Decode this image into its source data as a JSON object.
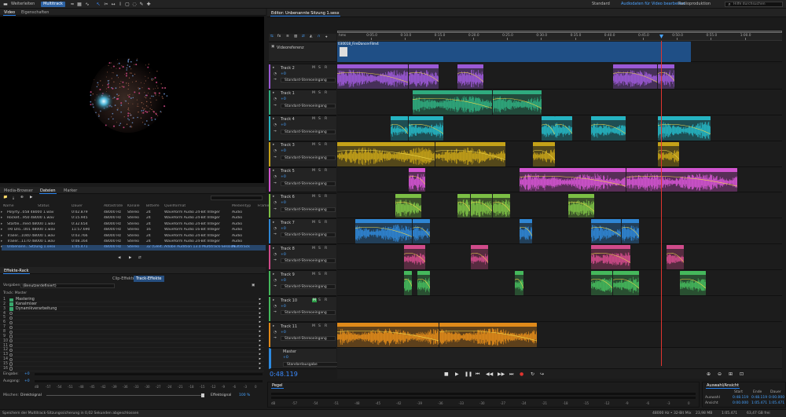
{
  "workspaces": [
    "Weiterleiten",
    "Multitrack"
  ],
  "top_right": {
    "items": [
      "Standard",
      "Audiodaten für Video bearbeiten",
      "Radioproduktion"
    ],
    "search_placeholder": "Hilfe durchsuchen"
  },
  "video_panel": {
    "tabs": [
      "Video",
      "Eigenschaften"
    ]
  },
  "media_panel": {
    "tabs": [
      "Media-Browser",
      "Dateien",
      "Marker"
    ],
    "columns": [
      "Name",
      "Status",
      "Dauer",
      "Abtastrate",
      "Kanäle",
      "Bittiefe",
      "Quellformat",
      "Medientyp",
      "Frame"
    ],
    "rows": [
      [
        "Polyrty...058 48000 1.wav",
        "",
        "0:02.879",
        "48000 Hz",
        "Stereo",
        "24",
        "Waveform Audio 24-Bit Integer",
        "Audio"
      ],
      [
        "Rocket...950 48000 1.wav",
        "",
        "0:15.945",
        "48000 Hz",
        "Stereo",
        "24",
        "Waveform Audio 24-Bit Integer",
        "Audio"
      ],
      [
        "Startle...med 48000 1.wav",
        "",
        "0:32.654",
        "48000 Hz",
        "Stereo",
        "24",
        "Waveform Audio 24-Bit Integer",
        "Audio"
      ],
      [
        "TRI Dro...001 48000 1.wav",
        "",
        "11:57.690",
        "48000 Hz",
        "Stereo",
        "16",
        "Waveform Audio 16-Bit Integer",
        "Audio"
      ],
      [
        "Trailer...1040 48000 1.wav",
        "",
        "0:03.766",
        "48000 Hz",
        "Stereo",
        "24",
        "Waveform Audio 24-Bit Integer",
        "Audio"
      ],
      [
        "Trailer...1170 48000 1.wav",
        "",
        "0:08.164",
        "48000 Hz",
        "Stereo",
        "24",
        "Waveform Audio 24-Bit Integer",
        "Audio"
      ],
      [
        "Unbenann...Sitzung 1.sesx",
        "",
        "1:05.471",
        "48000 Hz",
        "Stereo",
        "32 (Gleit...",
        "Adobe Audition 13.0 Multitrack-Session",
        "Multitrack"
      ]
    ]
  },
  "effects_panel": {
    "title": "Effekte-Rack",
    "tabs": [
      "Clip-Effekte",
      "Track-Effekte"
    ],
    "presets_label": "Vorgaben:",
    "presets_value": "(Benutzerdefiniert)",
    "track_label": "Track: Master",
    "slots": [
      {
        "n": "1",
        "name": "Mastering",
        "on": true
      },
      {
        "n": "2",
        "name": "Kanalmixer",
        "on": true
      },
      {
        "n": "3",
        "name": "Dynamikverarbeitung",
        "on": true
      },
      {
        "n": "4",
        "name": "",
        "on": false
      },
      {
        "n": "5",
        "name": "",
        "on": false
      },
      {
        "n": "6",
        "name": "",
        "on": false
      },
      {
        "n": "7",
        "name": "",
        "on": false
      },
      {
        "n": "8",
        "name": "",
        "on": false
      },
      {
        "n": "9",
        "name": "",
        "on": false
      },
      {
        "n": "10",
        "name": "",
        "on": false
      },
      {
        "n": "11",
        "name": "",
        "on": false
      },
      {
        "n": "12",
        "name": "",
        "on": false
      },
      {
        "n": "13",
        "name": "",
        "on": false
      },
      {
        "n": "14",
        "name": "",
        "on": false
      },
      {
        "n": "15",
        "name": "",
        "on": false
      },
      {
        "n": "16",
        "name": "",
        "on": false
      }
    ],
    "input_label": "Eingabe:",
    "output_label": "Ausgang:",
    "gain_value": "+0",
    "mix_label": "Mischen:",
    "mix_value": "Direktsignal",
    "fx_label": "Effektsignal",
    "fx_percent": "100 %",
    "meter_scale": [
      "dB",
      "-57",
      "-54",
      "-51",
      "-48",
      "-45",
      "-42",
      "-39",
      "-36",
      "-33",
      "-30",
      "-27",
      "-24",
      "-21",
      "-18",
      "-15",
      "-12",
      "-9",
      "-6",
      "-3",
      "0"
    ]
  },
  "editor": {
    "title": "Editor: Unbenannte Sitzung 1.sesx",
    "ruler_start": "hms",
    "ruler": [
      "0:05.0",
      "0:10.0",
      "0:15.0",
      "0:20.0",
      "0:25.0",
      "0:30.0",
      "0:35.0",
      "0:40.0",
      "0:45.0",
      "0:50.0",
      "0:55.0",
      "1:00.0"
    ],
    "video_track": {
      "name": "Videoreferenz",
      "clip": "030018_FireDancerFilm4"
    },
    "io_label": "Standard-Stereoeingang",
    "master_io": "Standardausgabe",
    "master_name": "Master",
    "vol": "+0",
    "tracks": [
      {
        "name": "Track 2",
        "color": "#9b59d6",
        "vol": "+0",
        "clips": [
          [
            "Trailer, Stinger, Impact, Suspense...",
            0.0,
            0.16
          ],
          [
            "Design, Whoo...",
            0.16,
            0.23
          ],
          [
            "Ambience...",
            0.27,
            0.33
          ],
          [
            "Drone, Empty, Void, Slid...",
            0.62,
            0.72
          ],
          [
            "Dro...",
            0.72,
            0.76
          ]
        ]
      },
      {
        "name": "Track 1",
        "color": "#2fab7e",
        "vol": "+0",
        "clips": [
          [
            "Human, Vocal, Whispering, Male, Close, Scary 1 5601...",
            0.17,
            0.35
          ],
          [
            "Impact Re...",
            0.35,
            0.46
          ]
        ]
      },
      {
        "name": "Track 4",
        "color": "#25b4c2",
        "vol": "+0",
        "clips": [
          [
            "",
            0.12,
            0.16
          ],
          [
            "Rocket, Space Ship...",
            0.16,
            0.24
          ],
          [
            "Plastic, Tray, Big...",
            0.46,
            0.49
          ],
          [
            "Plastic, Tray...",
            0.49,
            0.53
          ],
          [
            "Ambience Construct...",
            0.57,
            0.65
          ],
          [
            "Source, Impact, Dark Stream 01 5806 36...",
            0.72,
            0.84
          ]
        ]
      },
      {
        "name": "Track 3",
        "color": "#c5a218",
        "vol": "+0",
        "clips": [
          [
            "Ambience, Nature, Cricket Stream, Rain, Frogs, Dog Barks 5803838 4 48000 1",
            0.0,
            0.22
          ],
          [
            "Ambience, City, Rooftop, Distant Traffic Tone 5803832 48000 1",
            0.22,
            0.38
          ],
          [
            "Landstreicher",
            0.44,
            0.49
          ],
          [
            "Pop/UK...",
            0.72,
            0.77
          ]
        ]
      },
      {
        "name": "Track 5",
        "color": "#d254d0",
        "vol": "+0",
        "clips": [
          [
            "",
            0.16,
            0.2
          ],
          [
            "Starship Strings 1 normalized converted 48000 1",
            0.41,
            0.65
          ],
          [
            "Landstreicher",
            0.65,
            0.9
          ]
        ]
      },
      {
        "name": "Track 6",
        "color": "#7cbf45",
        "vol": "+0",
        "clips": [
          [
            "Electr...",
            0.13,
            0.19
          ],
          [
            "Electr...",
            0.27,
            0.3
          ],
          [
            "Electr...",
            0.3,
            0.35
          ],
          [
            "Electr...",
            0.35,
            0.39
          ],
          [
            "Electr...",
            0.52,
            0.58
          ]
        ]
      },
      {
        "name": "Track 7",
        "color": "#2f86d4",
        "vol": "+0",
        "clips": [
          [
            "Vehicles, Tractor, Approach, Stop, St...",
            0.04,
            0.17
          ],
          [
            "Crush M...",
            0.17,
            0.21
          ],
          [
            "",
            0.41,
            0.44
          ],
          [
            "Underwate...",
            0.57,
            0.64
          ],
          [
            "Underwate...",
            0.64,
            0.68
          ]
        ]
      },
      {
        "name": "Track 8",
        "color": "#d04b8a",
        "vol": "+0",
        "clips": [
          [
            "Crus...",
            0.15,
            0.2
          ],
          [
            "",
            0.3,
            0.34
          ],
          [
            "Alarm, Evacuation, Rollum...",
            0.57,
            0.66
          ],
          [
            "Trailer...",
            0.74,
            0.78
          ]
        ]
      },
      {
        "name": "Track 9",
        "color": "#45b85c",
        "vol": "+0",
        "clips": [
          [
            "",
            0.15,
            0.17
          ],
          [
            "",
            0.18,
            0.21
          ],
          [
            "",
            0.4,
            0.42
          ],
          [
            "Electronics, Ventilation F...",
            0.57,
            0.62
          ],
          [
            "Electroness...",
            0.62,
            0.68
          ],
          [
            "Trailer...",
            0.77,
            0.83
          ]
        ]
      },
      {
        "name": "Track 10",
        "color": "#45b85c",
        "vol": "+0",
        "clips": []
      },
      {
        "name": "Track 11",
        "color": "#e08a1a",
        "vol": "+0",
        "clips": [
          [
            "TRI Drone - 001 48000 1",
            0.0,
            0.23
          ],
          [
            "Balance",
            0.23,
            0.45
          ]
        ]
      }
    ]
  },
  "transport": {
    "time": "0:48.119"
  },
  "levels_panel": {
    "title": "Pegel",
    "scale": [
      "dB",
      "-57",
      "-54",
      "-51",
      "-48",
      "-45",
      "-42",
      "-39",
      "-36",
      "-33",
      "-30",
      "-27",
      "-24",
      "-21",
      "-18",
      "-15",
      "-12",
      "-9",
      "-6",
      "-3",
      "0"
    ]
  },
  "selection_panel": {
    "title": "Auswahl/Ansicht",
    "headers": [
      "Start",
      "Ende",
      "Dauer"
    ],
    "rows": [
      [
        "Auswahl",
        "0:48.119",
        "0:48.119",
        "0:00.000"
      ],
      [
        "Ansicht",
        "0:00.000",
        "1:05.471",
        "1:05.471"
      ]
    ]
  },
  "status": {
    "left": "Speichern der Multitrack-Sitzungssicherung in 0,02 Sekunden abgeschlossen",
    "right": [
      "48000 Hz • 32-Bit Mix",
      "23,98 MB",
      "1:05.471",
      "63,47 GB frei"
    ]
  }
}
